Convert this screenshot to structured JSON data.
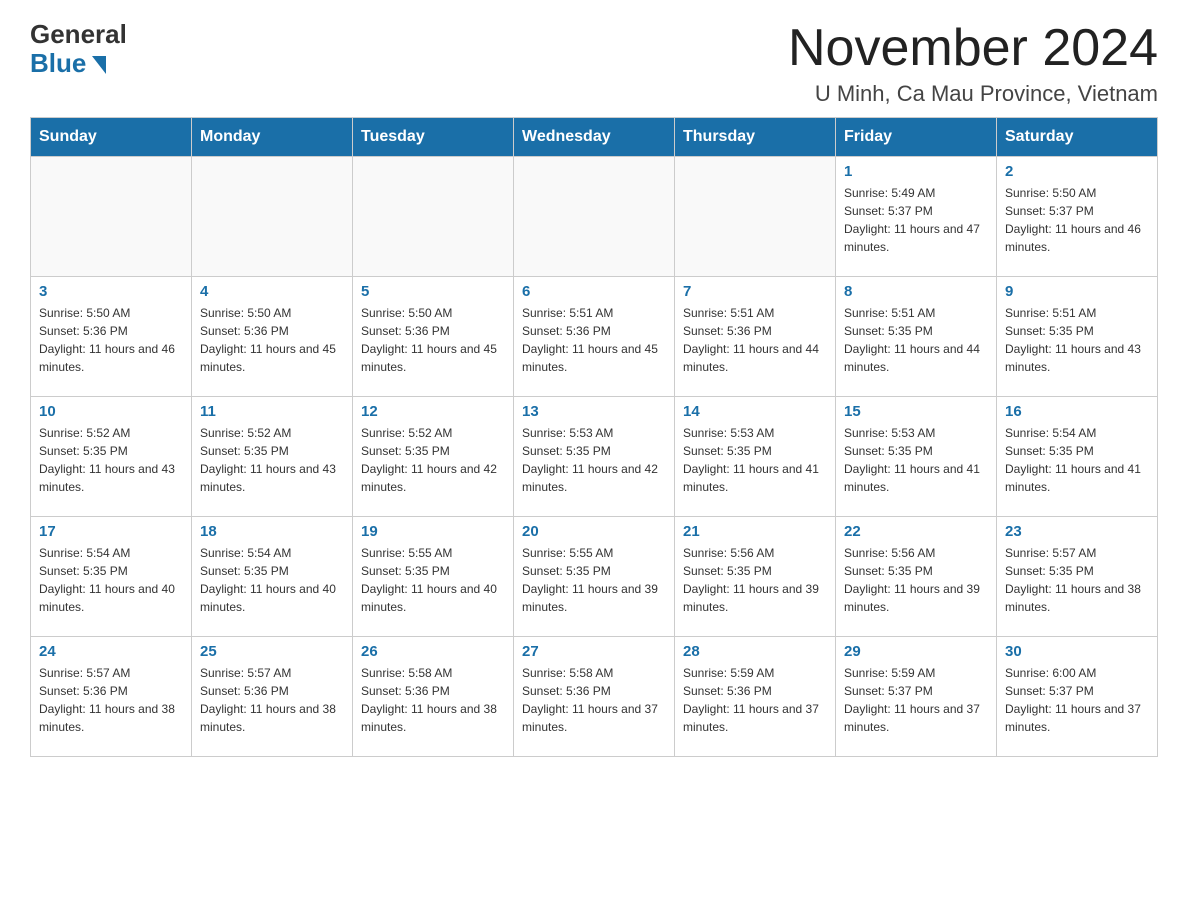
{
  "header": {
    "logo_general": "General",
    "logo_blue": "Blue",
    "month_title": "November 2024",
    "location": "U Minh, Ca Mau Province, Vietnam"
  },
  "weekdays": [
    "Sunday",
    "Monday",
    "Tuesday",
    "Wednesday",
    "Thursday",
    "Friday",
    "Saturday"
  ],
  "weeks": [
    [
      {
        "day": "",
        "info": ""
      },
      {
        "day": "",
        "info": ""
      },
      {
        "day": "",
        "info": ""
      },
      {
        "day": "",
        "info": ""
      },
      {
        "day": "",
        "info": ""
      },
      {
        "day": "1",
        "info": "Sunrise: 5:49 AM\nSunset: 5:37 PM\nDaylight: 11 hours and 47 minutes."
      },
      {
        "day": "2",
        "info": "Sunrise: 5:50 AM\nSunset: 5:37 PM\nDaylight: 11 hours and 46 minutes."
      }
    ],
    [
      {
        "day": "3",
        "info": "Sunrise: 5:50 AM\nSunset: 5:36 PM\nDaylight: 11 hours and 46 minutes."
      },
      {
        "day": "4",
        "info": "Sunrise: 5:50 AM\nSunset: 5:36 PM\nDaylight: 11 hours and 45 minutes."
      },
      {
        "day": "5",
        "info": "Sunrise: 5:50 AM\nSunset: 5:36 PM\nDaylight: 11 hours and 45 minutes."
      },
      {
        "day": "6",
        "info": "Sunrise: 5:51 AM\nSunset: 5:36 PM\nDaylight: 11 hours and 45 minutes."
      },
      {
        "day": "7",
        "info": "Sunrise: 5:51 AM\nSunset: 5:36 PM\nDaylight: 11 hours and 44 minutes."
      },
      {
        "day": "8",
        "info": "Sunrise: 5:51 AM\nSunset: 5:35 PM\nDaylight: 11 hours and 44 minutes."
      },
      {
        "day": "9",
        "info": "Sunrise: 5:51 AM\nSunset: 5:35 PM\nDaylight: 11 hours and 43 minutes."
      }
    ],
    [
      {
        "day": "10",
        "info": "Sunrise: 5:52 AM\nSunset: 5:35 PM\nDaylight: 11 hours and 43 minutes."
      },
      {
        "day": "11",
        "info": "Sunrise: 5:52 AM\nSunset: 5:35 PM\nDaylight: 11 hours and 43 minutes."
      },
      {
        "day": "12",
        "info": "Sunrise: 5:52 AM\nSunset: 5:35 PM\nDaylight: 11 hours and 42 minutes."
      },
      {
        "day": "13",
        "info": "Sunrise: 5:53 AM\nSunset: 5:35 PM\nDaylight: 11 hours and 42 minutes."
      },
      {
        "day": "14",
        "info": "Sunrise: 5:53 AM\nSunset: 5:35 PM\nDaylight: 11 hours and 41 minutes."
      },
      {
        "day": "15",
        "info": "Sunrise: 5:53 AM\nSunset: 5:35 PM\nDaylight: 11 hours and 41 minutes."
      },
      {
        "day": "16",
        "info": "Sunrise: 5:54 AM\nSunset: 5:35 PM\nDaylight: 11 hours and 41 minutes."
      }
    ],
    [
      {
        "day": "17",
        "info": "Sunrise: 5:54 AM\nSunset: 5:35 PM\nDaylight: 11 hours and 40 minutes."
      },
      {
        "day": "18",
        "info": "Sunrise: 5:54 AM\nSunset: 5:35 PM\nDaylight: 11 hours and 40 minutes."
      },
      {
        "day": "19",
        "info": "Sunrise: 5:55 AM\nSunset: 5:35 PM\nDaylight: 11 hours and 40 minutes."
      },
      {
        "day": "20",
        "info": "Sunrise: 5:55 AM\nSunset: 5:35 PM\nDaylight: 11 hours and 39 minutes."
      },
      {
        "day": "21",
        "info": "Sunrise: 5:56 AM\nSunset: 5:35 PM\nDaylight: 11 hours and 39 minutes."
      },
      {
        "day": "22",
        "info": "Sunrise: 5:56 AM\nSunset: 5:35 PM\nDaylight: 11 hours and 39 minutes."
      },
      {
        "day": "23",
        "info": "Sunrise: 5:57 AM\nSunset: 5:35 PM\nDaylight: 11 hours and 38 minutes."
      }
    ],
    [
      {
        "day": "24",
        "info": "Sunrise: 5:57 AM\nSunset: 5:36 PM\nDaylight: 11 hours and 38 minutes."
      },
      {
        "day": "25",
        "info": "Sunrise: 5:57 AM\nSunset: 5:36 PM\nDaylight: 11 hours and 38 minutes."
      },
      {
        "day": "26",
        "info": "Sunrise: 5:58 AM\nSunset: 5:36 PM\nDaylight: 11 hours and 38 minutes."
      },
      {
        "day": "27",
        "info": "Sunrise: 5:58 AM\nSunset: 5:36 PM\nDaylight: 11 hours and 37 minutes."
      },
      {
        "day": "28",
        "info": "Sunrise: 5:59 AM\nSunset: 5:36 PM\nDaylight: 11 hours and 37 minutes."
      },
      {
        "day": "29",
        "info": "Sunrise: 5:59 AM\nSunset: 5:37 PM\nDaylight: 11 hours and 37 minutes."
      },
      {
        "day": "30",
        "info": "Sunrise: 6:00 AM\nSunset: 5:37 PM\nDaylight: 11 hours and 37 minutes."
      }
    ]
  ]
}
